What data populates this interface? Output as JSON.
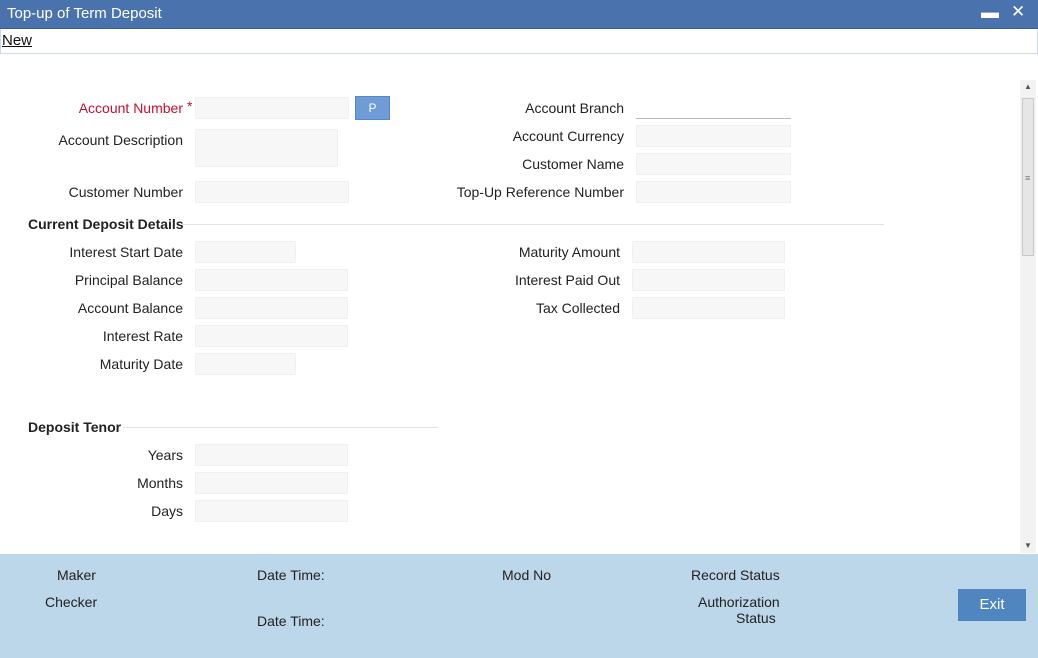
{
  "window": {
    "title": "Top-up of Term Deposit"
  },
  "menu": {
    "new_label": "New"
  },
  "form": {
    "account_number_label": "Account Number",
    "required_mark": "*",
    "p_button_label": "P",
    "account_description_label": "Account Description",
    "customer_number_label": "Customer Number",
    "account_branch_label": "Account Branch",
    "account_currency_label": "Account Currency",
    "customer_name_label": "Customer Name",
    "topup_reference_label": "Top-Up Reference Number"
  },
  "current_deposit": {
    "heading": "Current Deposit Details",
    "interest_start_date_label": "Interest Start Date",
    "principal_balance_label": "Principal Balance",
    "account_balance_label": "Account Balance",
    "interest_rate_label": "Interest Rate",
    "maturity_date_label": "Maturity Date",
    "maturity_amount_label": "Maturity Amount",
    "interest_paid_out_label": "Interest Paid Out",
    "tax_collected_label": "Tax Collected"
  },
  "tenor": {
    "heading": "Deposit Tenor",
    "years_label": "Years",
    "months_label": "Months",
    "days_label": "Days"
  },
  "footer": {
    "maker_label": "Maker",
    "checker_label": "Checker",
    "date_time_label_1": "Date Time:",
    "date_time_label_2": "Date Time:",
    "mod_no_label": "Mod No",
    "record_status_label": "Record Status",
    "authorization_label": "Authorization",
    "status_label": "Status",
    "exit_label": "Exit"
  }
}
